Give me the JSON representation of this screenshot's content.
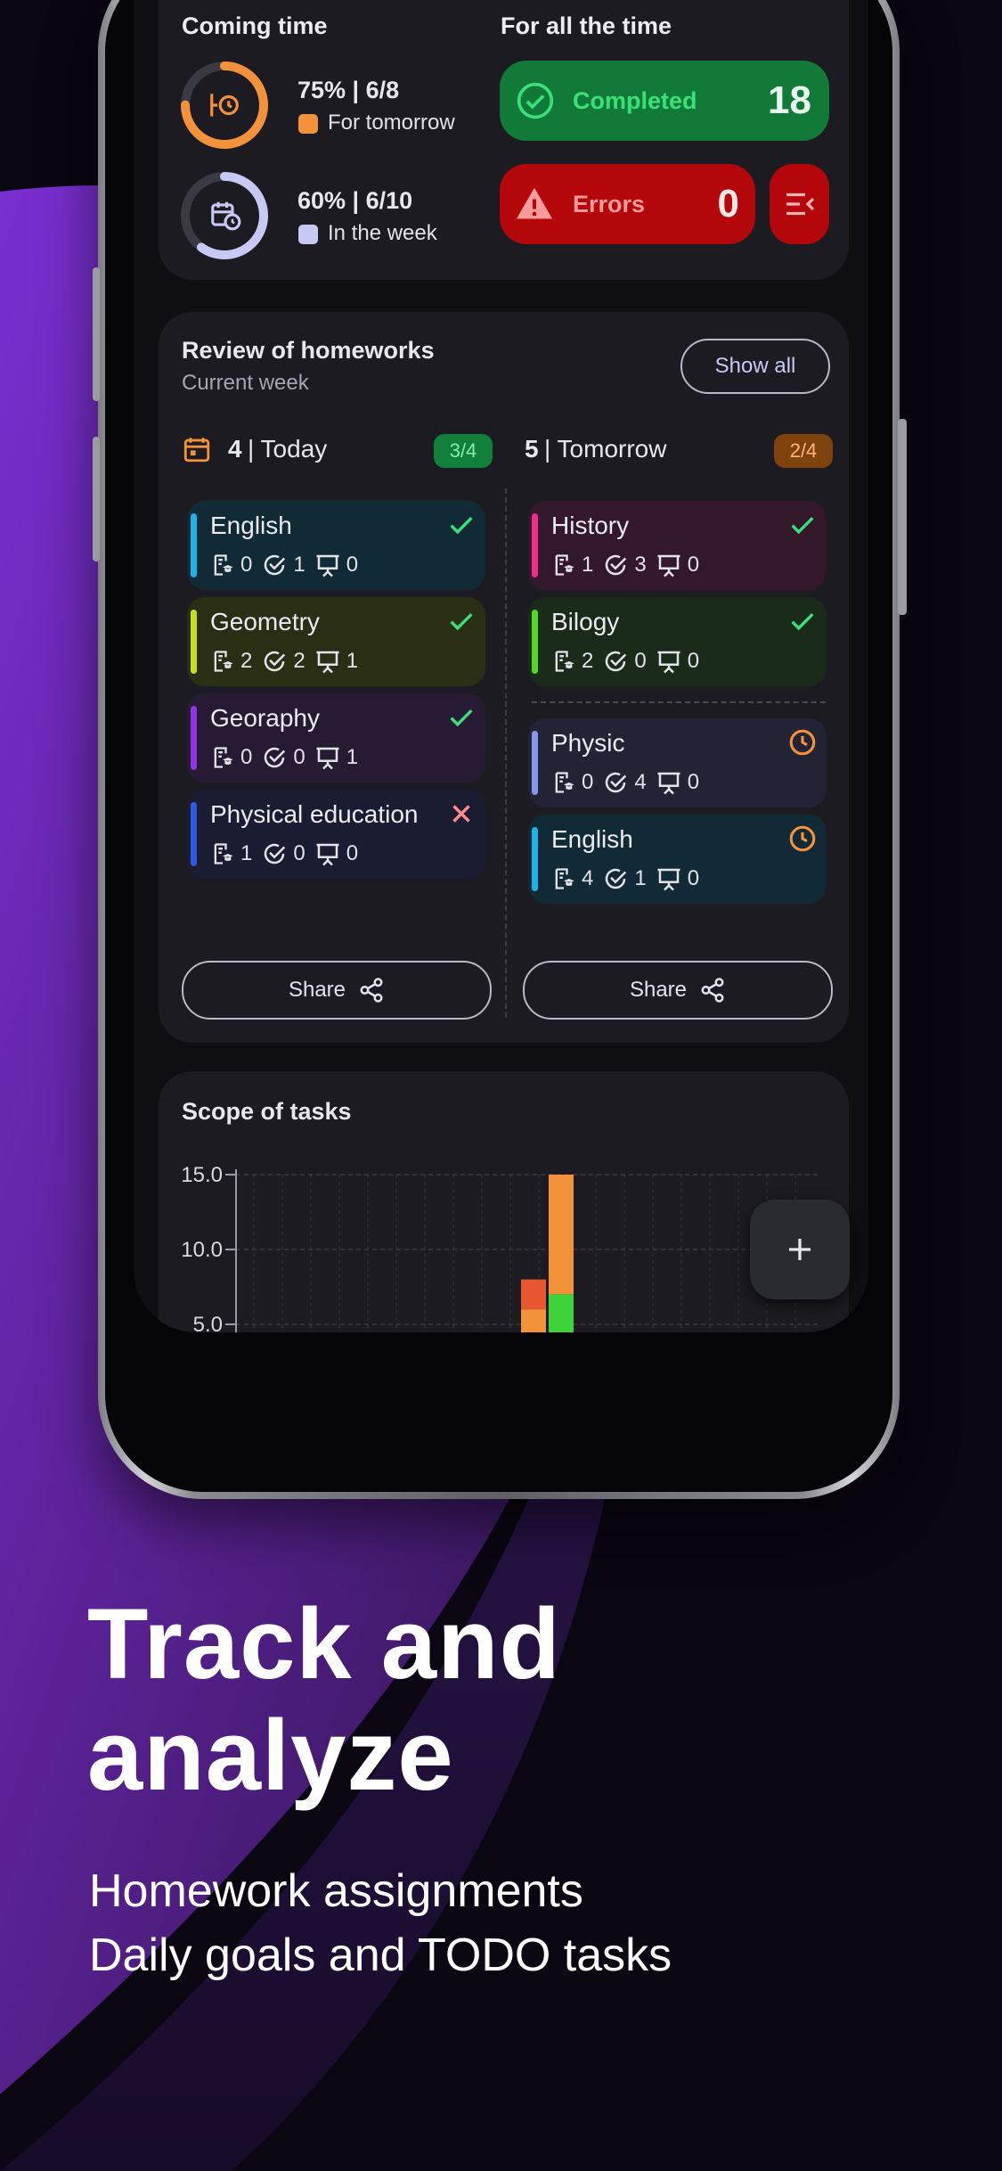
{
  "coming_time": {
    "title": "Coming time",
    "tomorrow": {
      "summary": "75% | 6/8",
      "label": "For tomorrow",
      "percent": 75,
      "color": "#f4923b"
    },
    "week": {
      "summary": "60% | 6/10",
      "label": "In the week",
      "percent": 60,
      "color": "#c8c8f4"
    }
  },
  "all_time": {
    "title": "For all the time",
    "completed_label": "Completed",
    "completed_count": "18",
    "errors_label": "Errors",
    "errors_count": "0"
  },
  "review": {
    "title": "Review of homeworks",
    "subtitle": "Current week",
    "show_all": "Show all",
    "today": {
      "day": "4",
      "label": "| Today",
      "badge": "3/4",
      "subjects": [
        {
          "name": "English",
          "color": "#1fb1e8",
          "bg": "#122a35",
          "a": "0",
          "b": "1",
          "c": "0",
          "status": "done"
        },
        {
          "name": "Geometry",
          "color": "#c7de1e",
          "bg": "#2a2e15",
          "a": "2",
          "b": "2",
          "c": "1",
          "status": "done"
        },
        {
          "name": "Georaphy",
          "color": "#8f35e6",
          "bg": "#271b33",
          "a": "0",
          "b": "0",
          "c": "1",
          "status": "done"
        },
        {
          "name": "Physical education",
          "color": "#2f58e6",
          "bg": "#1a1d32",
          "a": "1",
          "b": "0",
          "c": "0",
          "status": "fail"
        }
      ],
      "share": "Share"
    },
    "tomorrow": {
      "day": "5",
      "label": "| Tomorrow",
      "badge": "2/4",
      "subjects": [
        {
          "name": "History",
          "color": "#ee2d8a",
          "bg": "#321828",
          "a": "1",
          "b": "3",
          "c": "0",
          "status": "done"
        },
        {
          "name": "Bilogy",
          "color": "#52d81e",
          "bg": "#1b2b1a",
          "a": "2",
          "b": "0",
          "c": "0",
          "status": "done"
        },
        {
          "name": "Physic",
          "color": "#8a95f0",
          "bg": "#222436",
          "a": "0",
          "b": "4",
          "c": "0",
          "status": "pending"
        },
        {
          "name": "English",
          "color": "#1fb1e8",
          "bg": "#122a35",
          "a": "4",
          "b": "1",
          "c": "0",
          "status": "pending"
        }
      ],
      "share": "Share"
    }
  },
  "scope": {
    "title": "Scope of tasks"
  },
  "chart_data": {
    "type": "bar",
    "ylim": [
      5,
      15
    ],
    "y_ticks": [
      "15.0",
      "10.0",
      "5.0"
    ],
    "series": [
      {
        "color": "#f4923b",
        "values": [
          6,
          15
        ]
      },
      {
        "color": "#e8552e",
        "values": [
          8,
          0
        ]
      },
      {
        "color": "#3ed33b",
        "values": [
          0,
          7
        ]
      }
    ]
  },
  "headline": {
    "line1": "Track and",
    "line2": "analyze"
  },
  "subhead": {
    "line1": "Homework assignments",
    "line2": "Daily goals and TODO tasks"
  },
  "colors": {
    "accent": "#b9b9f0",
    "completed_bg": "#127a38",
    "completed_text": "#3ae07a",
    "errors_bg": "#b4070b",
    "errors_text": "#ff9a9a",
    "today_badge_bg": "#12803c",
    "tomorrow_badge_bg": "#80420d"
  }
}
